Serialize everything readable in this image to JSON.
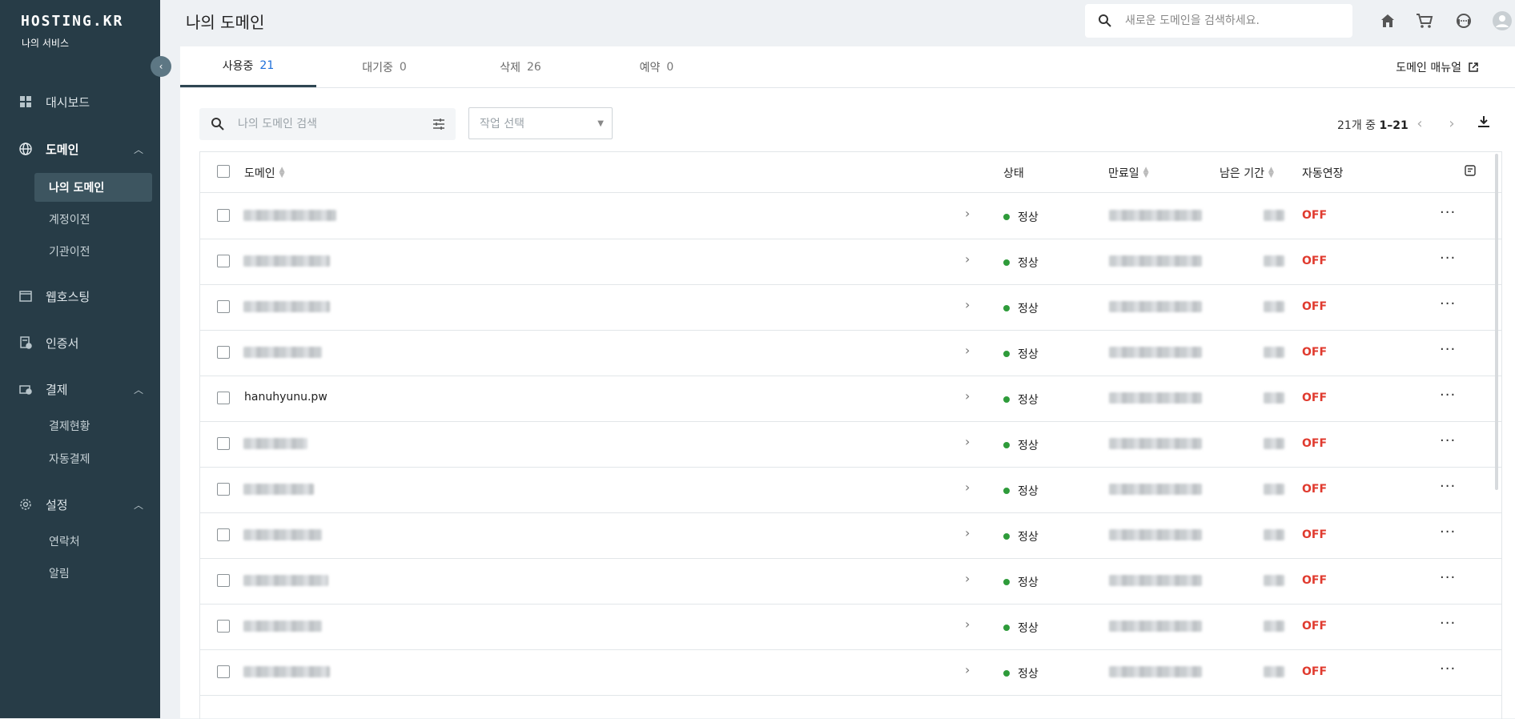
{
  "sidebar": {
    "logo": "HOSTING.KR",
    "subtitle": "나의 서비스",
    "collapse_icon": "chevron-left-icon",
    "nav": [
      {
        "label": "대시보드",
        "icon": "dashboard-icon"
      },
      {
        "label": "도메인",
        "icon": "globe-icon"
      },
      {
        "label": "웹호스팅",
        "icon": "window-icon"
      },
      {
        "label": "인증서",
        "icon": "certificate-icon"
      },
      {
        "label": "결제",
        "icon": "payment-icon"
      },
      {
        "label": "설정",
        "icon": "gear-icon"
      }
    ],
    "domain_sub": [
      "나의 도메인",
      "계정이전",
      "기관이전"
    ],
    "payment_sub": [
      "결제현황",
      "자동결제"
    ],
    "settings_sub": [
      "연락처",
      "알림"
    ]
  },
  "header": {
    "title": "나의 도메인",
    "search_placeholder": "새로운 도메인을 검색하세요.",
    "icons": [
      "home-icon",
      "cart-icon",
      "support-icon",
      "account-icon"
    ]
  },
  "tabs": [
    {
      "label": "사용중",
      "count": "21"
    },
    {
      "label": "대기중",
      "count": "0"
    },
    {
      "label": "삭제",
      "count": "26"
    },
    {
      "label": "예약",
      "count": "0"
    }
  ],
  "manual_link": "도메인 매뉴얼",
  "toolbar": {
    "filter_placeholder": "나의 도메인 검색",
    "action_select": "작업 선택",
    "pager_prefix": "21개 중 ",
    "pager_range": "1–21"
  },
  "table": {
    "headers": {
      "domain": "도메인",
      "status": "상태",
      "expiry": "만료일",
      "remaining": "남은 기간",
      "auto_renew": "자동연장"
    },
    "rows": [
      {
        "domain": "",
        "status": "정상",
        "auto_renew": "OFF"
      },
      {
        "domain": "",
        "status": "정상",
        "auto_renew": "OFF"
      },
      {
        "domain": "",
        "status": "정상",
        "auto_renew": "OFF"
      },
      {
        "domain": "",
        "status": "정상",
        "auto_renew": "OFF"
      },
      {
        "domain": "hanuhyunu.pw",
        "status": "정상",
        "auto_renew": "OFF"
      },
      {
        "domain": "",
        "status": "정상",
        "auto_renew": "OFF"
      },
      {
        "domain": "",
        "status": "정상",
        "auto_renew": "OFF"
      },
      {
        "domain": "",
        "status": "정상",
        "auto_renew": "OFF"
      },
      {
        "domain": "",
        "status": "정상",
        "auto_renew": "OFF"
      },
      {
        "domain": "",
        "status": "정상",
        "auto_renew": "OFF"
      },
      {
        "domain": "",
        "status": "정상",
        "auto_renew": "OFF"
      }
    ]
  }
}
